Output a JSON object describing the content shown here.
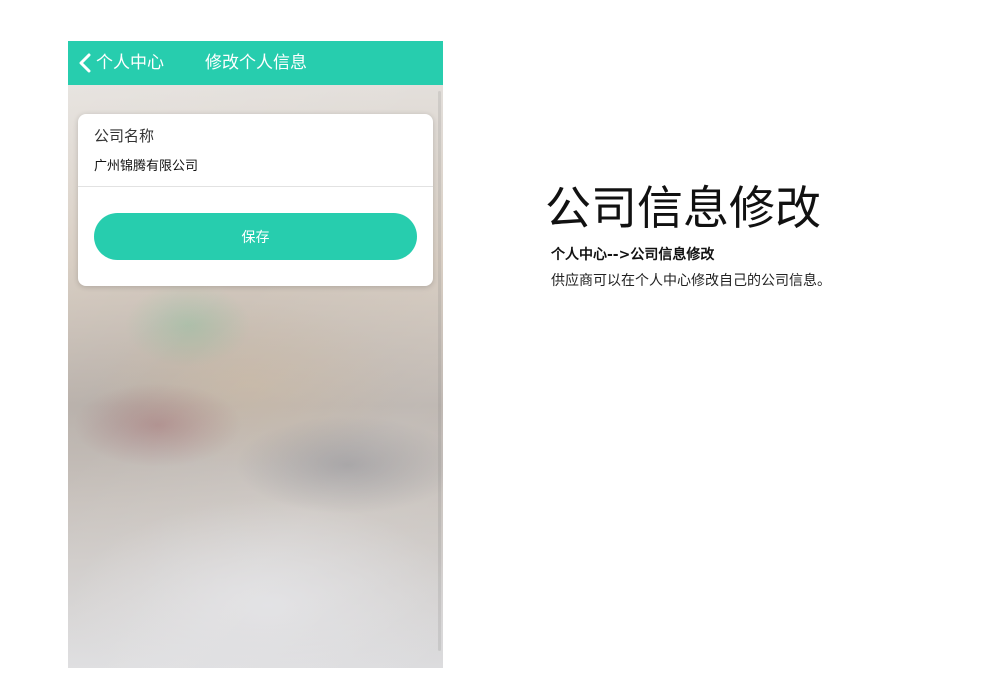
{
  "navbar": {
    "back_label": "个人中心",
    "title": "修改个人信息",
    "color": "#27cdae"
  },
  "form": {
    "company_label": "公司名称",
    "company_value": "广州锦腾有限公司",
    "save_label": "保存"
  },
  "description": {
    "title": "公司信息修改",
    "path": "个人中心-->公司信息修改",
    "text": "供应商可以在个人中心修改自己的公司信息。"
  }
}
